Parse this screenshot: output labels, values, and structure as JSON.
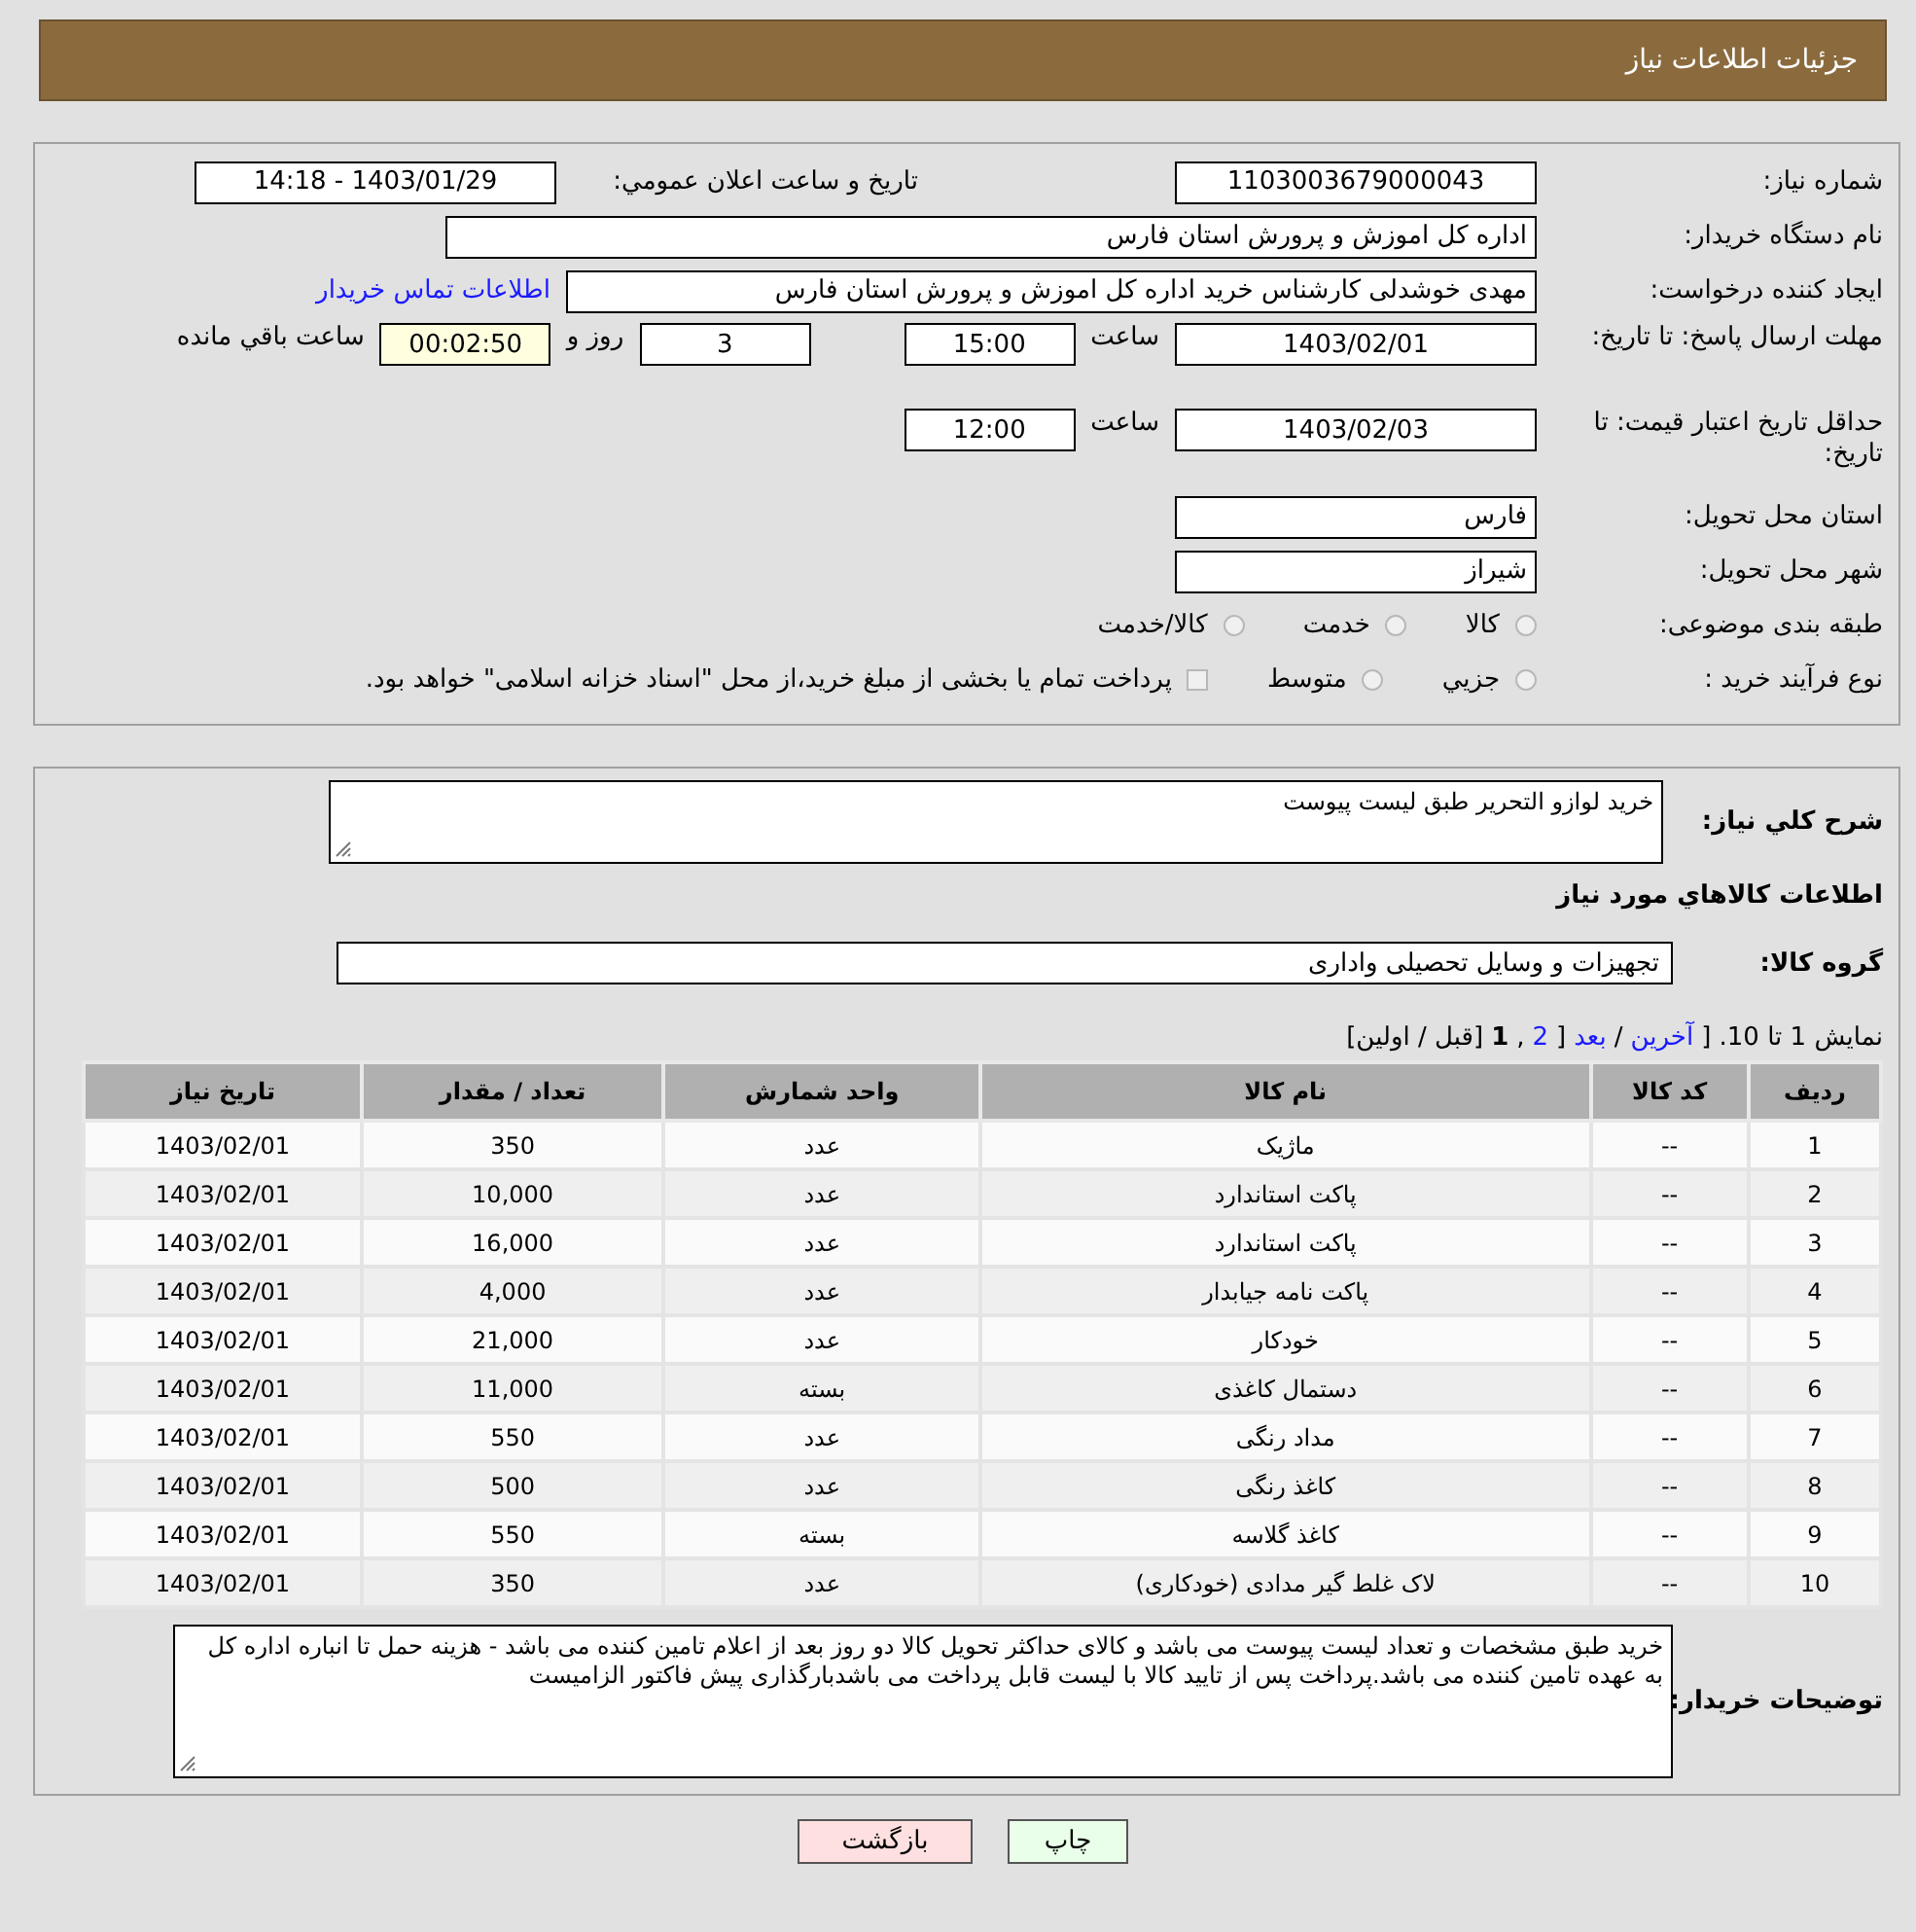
{
  "header": {
    "title": "جزئیات اطلاعات نیاز"
  },
  "details": [
    {
      "items": [
        {
          "kind": "label",
          "text": "شماره نیاز:"
        },
        {
          "kind": "field",
          "text": "1103003679000043"
        },
        {
          "kind": "sublabel",
          "text": "تاریخ و ساعت اعلان عمومي:"
        },
        {
          "kind": "field",
          "text": "1403/01/29 - 14:18"
        }
      ]
    },
    {
      "items": [
        {
          "kind": "label",
          "text": "نام دستگاه خریدار:"
        },
        {
          "kind": "field_long",
          "text": "اداره کل اموزش و پرورش استان فارس"
        }
      ]
    },
    {
      "items": [
        {
          "kind": "label",
          "text": "ایجاد کننده درخواست:"
        },
        {
          "kind": "field_wide",
          "text": "مهدی خوشدلی کارشناس خرید اداره کل اموزش و پرورش استان فارس"
        },
        {
          "kind": "link",
          "text": "اطلاعات تماس خریدار"
        }
      ]
    },
    {
      "items": [
        {
          "kind": "label",
          "text": "مهلت ارسال پاسخ: تا تاریخ:"
        },
        {
          "kind": "field",
          "text": "1403/02/01"
        },
        {
          "kind": "text",
          "text": "ساعت"
        },
        {
          "kind": "field_short",
          "text": "15:00"
        },
        {
          "kind": "field_short",
          "text": "3"
        },
        {
          "kind": "text",
          "text": "روز و"
        },
        {
          "kind": "timer",
          "text": "00:02:50"
        },
        {
          "kind": "text",
          "text": "ساعت باقي مانده"
        }
      ]
    },
    {
      "items": [
        {
          "kind": "label",
          "text": "حداقل تاریخ اعتبار قیمت: تا تاریخ:"
        },
        {
          "kind": "field",
          "text": "1403/02/03"
        },
        {
          "kind": "text",
          "text": "ساعت"
        },
        {
          "kind": "field_short",
          "text": "12:00"
        }
      ]
    },
    {
      "items": [
        {
          "kind": "label",
          "text": "استان محل تحویل:"
        },
        {
          "kind": "field_right",
          "text": "فارس"
        }
      ]
    },
    {
      "items": [
        {
          "kind": "label",
          "text": "شهر محل تحویل:"
        },
        {
          "kind": "field_right",
          "text": "شیراز"
        }
      ]
    },
    {
      "items": [
        {
          "kind": "label",
          "text": "طبقه بندی موضوعی:"
        },
        {
          "kind": "radio",
          "text": "کالا",
          "selected": false
        },
        {
          "kind": "radio",
          "text": "خدمت",
          "selected": false
        },
        {
          "kind": "radio",
          "text": "کالا/خدمت",
          "selected": false
        }
      ]
    },
    {
      "items": [
        {
          "kind": "label",
          "text": "نوع فرآیند خرید :"
        },
        {
          "kind": "radio",
          "text": "جزيي",
          "selected": false
        },
        {
          "kind": "radio",
          "text": "متوسط",
          "selected": false
        },
        {
          "kind": "checkbox",
          "text": "پرداخت تمام یا بخشی از مبلغ خرید،از محل \"اسناد خزانه اسلامی\" خواهد بود.",
          "checked": false
        }
      ]
    }
  ],
  "description": {
    "label": "شرح کلي نیاز:",
    "value": "خرید لوازو التحریر طبق لیست پیوست"
  },
  "goods_heading": "اطلاعات کالاهاي مورد نیاز",
  "goods_group": {
    "label": "گروه کالا:",
    "value": "تجهیزات و وسایل تحصیلی واداری"
  },
  "pagination": [
    {
      "kind": "text",
      "text": "نمایش 1 تا 10. ["
    },
    {
      "kind": "link",
      "text": "آخرین"
    },
    {
      "kind": "text",
      "text": "/"
    },
    {
      "kind": "link",
      "text": "بعد"
    },
    {
      "kind": "text",
      "text": "]"
    },
    {
      "kind": "link",
      "text": "2"
    },
    {
      "kind": "text",
      "text": ","
    },
    {
      "kind": "current",
      "text": "1"
    },
    {
      "kind": "text",
      "text": "[قبل / اولین]"
    }
  ],
  "table": {
    "columns": [
      "ردیف",
      "کد کالا",
      "نام کالا",
      "واحد شمارش",
      "تعداد / مقدار",
      "تاریخ نیاز"
    ],
    "rows": [
      [
        "1",
        "--",
        "ماژیک",
        "عدد",
        "350",
        "1403/02/01"
      ],
      [
        "2",
        "--",
        "پاکت استاندارد",
        "عدد",
        "10,000",
        "1403/02/01"
      ],
      [
        "3",
        "--",
        "پاکت استاندارد",
        "عدد",
        "16,000",
        "1403/02/01"
      ],
      [
        "4",
        "--",
        "پاکت نامه جیابدار",
        "عدد",
        "4,000",
        "1403/02/01"
      ],
      [
        "5",
        "--",
        "خودکار",
        "عدد",
        "21,000",
        "1403/02/01"
      ],
      [
        "6",
        "--",
        "دستمال کاغذی",
        "بسته",
        "11,000",
        "1403/02/01"
      ],
      [
        "7",
        "--",
        "مداد رنگی",
        "عدد",
        "550",
        "1403/02/01"
      ],
      [
        "8",
        "--",
        "کاغذ رنگی",
        "عدد",
        "500",
        "1403/02/01"
      ],
      [
        "9",
        "--",
        "کاغذ گلاسه",
        "بسته",
        "550",
        "1403/02/01"
      ],
      [
        "10",
        "--",
        "لاک غلط گیر مدادی (خودکاری)",
        "عدد",
        "350",
        "1403/02/01"
      ]
    ]
  },
  "buyer_notes": {
    "label": "توضیحات خریدار:",
    "value": "خرید طبق مشخصات و تعداد لیست  پیوست می باشد و کالای حداکثر تحویل کالا دو روز بعد از اعلام تامین کننده می باشد - هزینه حمل تا انباره اداره کل به عهده تامین کننده می باشد.پرداخت پس از تایید کالا با لیست قابل پرداخت می باشدبارگذاری پیش فاکتور الزامیست"
  },
  "buttons": [
    {
      "kind": "print",
      "text": "چاپ"
    },
    {
      "kind": "back",
      "text": "بازگشت"
    }
  ]
}
